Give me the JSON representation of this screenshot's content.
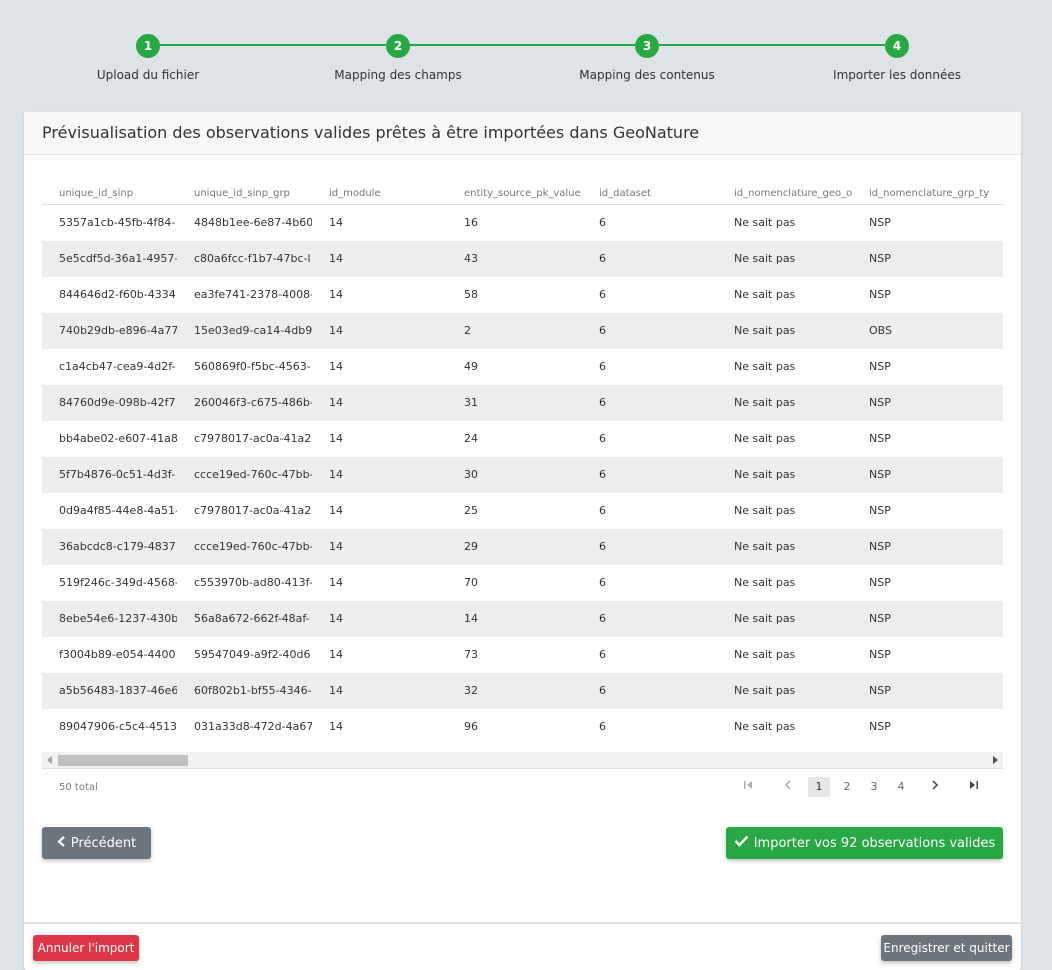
{
  "stepper": {
    "steps": [
      {
        "number": "1",
        "label": "Upload du fichier"
      },
      {
        "number": "2",
        "label": "Mapping des champs"
      },
      {
        "number": "3",
        "label": "Mapping des contenus"
      },
      {
        "number": "4",
        "label": "Importer les données"
      }
    ]
  },
  "card": {
    "title": "Prévisualisation des observations valides prêtes à être importées dans GeoNature"
  },
  "table": {
    "columns": [
      "unique_id_sinp",
      "unique_id_sinp_grp",
      "id_module",
      "entity_source_pk_value",
      "id_dataset",
      "id_nomenclature_geo_ol",
      "id_nomenclature_grp_ty"
    ],
    "rows": [
      [
        "5357a1cb-45fb-4f84-",
        "4848b1ee-6e87-4b60",
        "14",
        "16",
        "6",
        "Ne sait pas",
        "NSP"
      ],
      [
        "5e5cdf5d-36a1-4957-",
        "c80a6fcc-f1b7-47bc-l",
        "14",
        "43",
        "6",
        "Ne sait pas",
        "NSP"
      ],
      [
        "844646d2-f60b-4334",
        "ea3fe741-2378-4008-",
        "14",
        "58",
        "6",
        "Ne sait pas",
        "NSP"
      ],
      [
        "740b29db-e896-4a77",
        "15e03ed9-ca14-4db9",
        "14",
        "2",
        "6",
        "Ne sait pas",
        "OBS"
      ],
      [
        "c1a4cb47-cea9-4d2f-",
        "560869f0-f5bc-4563-",
        "14",
        "49",
        "6",
        "Ne sait pas",
        "NSP"
      ],
      [
        "84760d9e-098b-42f7",
        "260046f3-c675-486b-",
        "14",
        "31",
        "6",
        "Ne sait pas",
        "NSP"
      ],
      [
        "bb4abe02-e607-41a8",
        "c7978017-ac0a-41a2-",
        "14",
        "24",
        "6",
        "Ne sait pas",
        "NSP"
      ],
      [
        "5f7b4876-0c51-4d3f-",
        "ccce19ed-760c-47bb-",
        "14",
        "30",
        "6",
        "Ne sait pas",
        "NSP"
      ],
      [
        "0d9a4f85-44e8-4a51-",
        "c7978017-ac0a-41a2-",
        "14",
        "25",
        "6",
        "Ne sait pas",
        "NSP"
      ],
      [
        "36abcdc8-c179-4837",
        "ccce19ed-760c-47bb-",
        "14",
        "29",
        "6",
        "Ne sait pas",
        "NSP"
      ],
      [
        "519f246c-349d-4568-",
        "c553970b-ad80-413f-",
        "14",
        "70",
        "6",
        "Ne sait pas",
        "NSP"
      ],
      [
        "8ebe54e6-1237-430b",
        "56a8a672-662f-48af-",
        "14",
        "14",
        "6",
        "Ne sait pas",
        "NSP"
      ],
      [
        "f3004b89-e054-4400",
        "59547049-a9f2-40d6",
        "14",
        "73",
        "6",
        "Ne sait pas",
        "NSP"
      ],
      [
        "a5b56483-1837-46e6",
        "60f802b1-bf55-4346-",
        "14",
        "32",
        "6",
        "Ne sait pas",
        "NSP"
      ],
      [
        "89047906-c5c4-4513",
        "031a33d8-472d-4a67",
        "14",
        "96",
        "6",
        "Ne sait pas",
        "NSP"
      ]
    ],
    "total": "50 total"
  },
  "pager": {
    "pages": [
      "1",
      "2",
      "3",
      "4"
    ],
    "active": "1",
    "first_icon": "first-page-icon",
    "prev_icon": "chevron-left-icon",
    "next_icon": "chevron-right-icon",
    "last_icon": "last-page-icon"
  },
  "actions": {
    "prev_label": "Précédent",
    "import_label": "Importer vos 92 observations valides",
    "cancel_label": "Annuler l'import",
    "save_label": "Enregistrer et quitter"
  },
  "colors": {
    "success": "#28a745",
    "secondary": "#6c757d",
    "danger": "#dc3545",
    "background": "#dde3e7"
  }
}
